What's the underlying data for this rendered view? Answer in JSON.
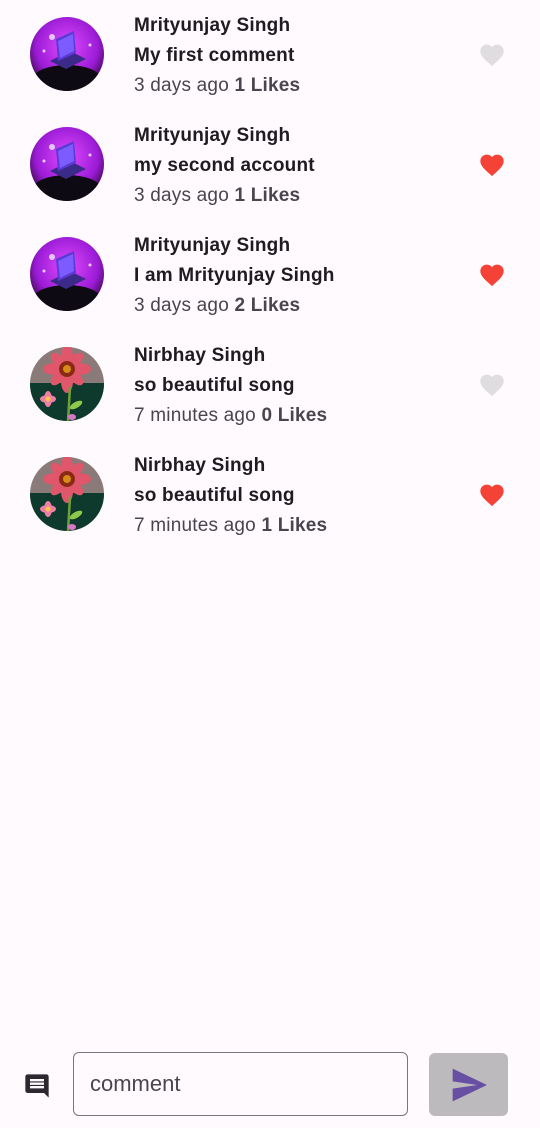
{
  "comments": [
    {
      "author": "Mrityunjay Singh",
      "text": "My first comment",
      "time": "3 days ago",
      "likes": "1",
      "likes_word": "Likes",
      "liked": false,
      "avatar": "laptop-avatar"
    },
    {
      "author": "Mrityunjay Singh",
      "text": "my second account",
      "time": "3 days ago",
      "likes": "1",
      "likes_word": "Likes",
      "liked": true,
      "avatar": "laptop-avatar"
    },
    {
      "author": "Mrityunjay Singh",
      "text": "I am Mrityunjay Singh",
      "time": "3 days ago",
      "likes": "2",
      "likes_word": "Likes",
      "liked": true,
      "avatar": "laptop-avatar"
    },
    {
      "author": "Nirbhay Singh",
      "text": "so beautiful song",
      "time": "7 minutes ago",
      "likes": "0",
      "likes_word": "Likes",
      "liked": false,
      "avatar": "flower-avatar"
    },
    {
      "author": "Nirbhay Singh",
      "text": "so beautiful song",
      "time": "7 minutes ago",
      "likes": "1",
      "likes_word": "Likes",
      "liked": true,
      "avatar": "flower-avatar"
    }
  ],
  "composer": {
    "placeholder": "comment",
    "value": "",
    "leading_icon": "comment-icon",
    "send_icon": "send-icon"
  },
  "colors": {
    "background": "#fefafe",
    "heart_liked": "#f44336",
    "heart_unliked": "#e0dde0",
    "send_button_bg": "#bdbabd",
    "send_icon": "#6750a4",
    "text_primary": "#1f1b20",
    "text_secondary": "#49454f"
  }
}
